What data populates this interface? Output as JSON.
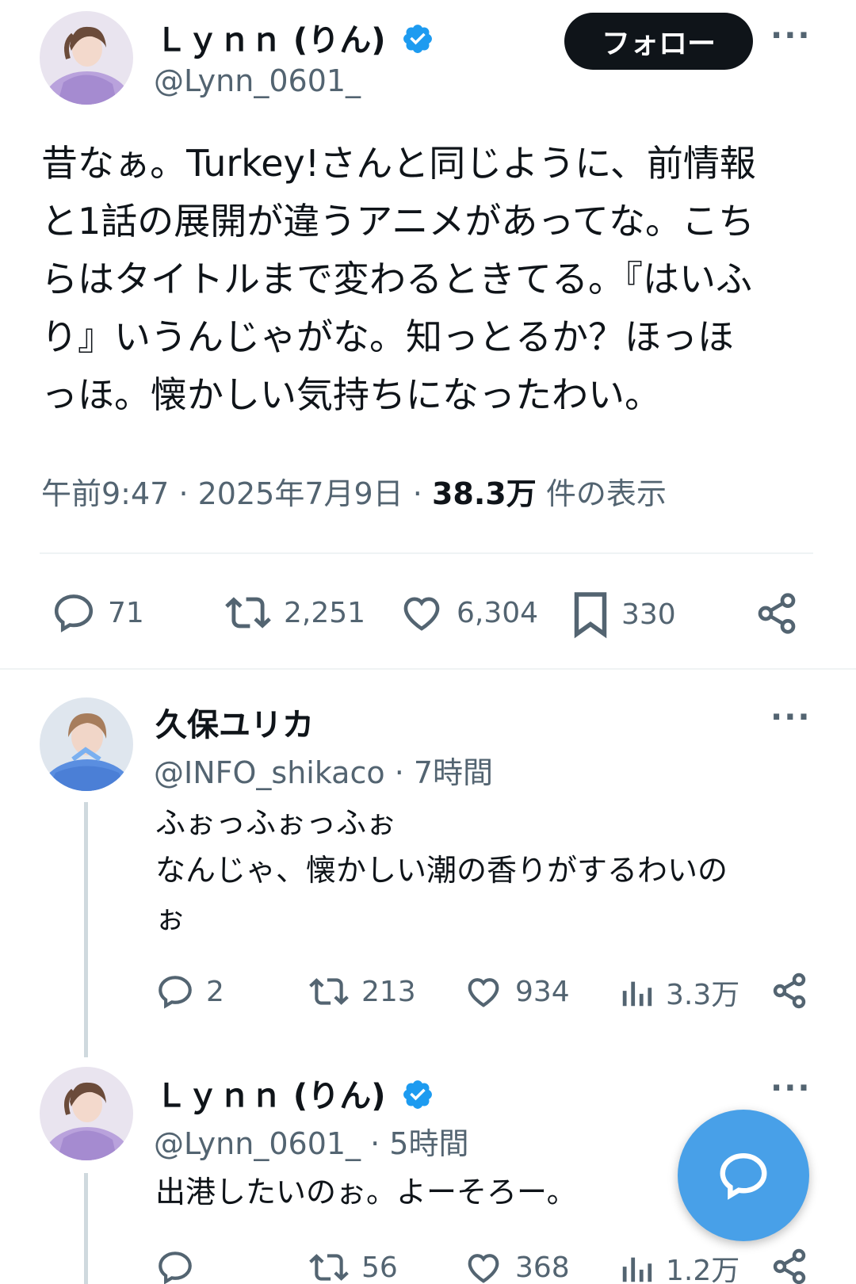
{
  "main_post": {
    "name": "Ｌｙｎｎ (りん)",
    "handle": "@Lynn_0601_",
    "follow_label": "フォロー",
    "more": "···",
    "lines": [
      "昔なぁ。Turkey!さんと同じように、前情報",
      "と1話の展開が違うアニメがあってな。こち",
      "らはタイトルまで変わるときてる。『はいふ",
      "り』いうんじゃがな。知っとるか？ほっほ",
      "っほ。懐かしい気持ちになったわい。"
    ],
    "time": "午前9:47",
    "date": "2025年7月9日",
    "sep": "·",
    "views_count": "38.3万",
    "views_label": "件の表示",
    "stats": {
      "replies": "71",
      "retweets": "2,251",
      "likes": "6,304",
      "bookmarks": "330"
    }
  },
  "replies": [
    {
      "name": "久保ユリカ",
      "handle": "@INFO_shikaco",
      "time": "· 7時間",
      "more": "···",
      "lines": [
        "ふぉっふぉっふぉ",
        "なんじゃ、懐かしい潮の香りがするわいの",
        "ぉ"
      ],
      "stats": {
        "replies": "2",
        "retweets": "213",
        "likes": "934",
        "views": "3.3万"
      }
    },
    {
      "name": "Ｌｙｎｎ (りん)",
      "handle": "@Lynn_0601_",
      "time": "· 5時間",
      "more": "···",
      "lines": [
        "出港したいのぉ。よーそろー。"
      ],
      "stats": {
        "replies": "",
        "retweets": "56",
        "likes": "368",
        "views": "1.2万"
      }
    }
  ],
  "colors": {
    "text": "#0f1419",
    "secondary": "#536471",
    "verified": "#1d9bf0",
    "fab": "#48a0e8",
    "divider": "#eff3f4",
    "thread_line": "#cfd9de"
  },
  "icons": {
    "reply": "speech-bubble-icon",
    "retweet": "retweet-icon",
    "like": "heart-icon",
    "bookmark": "bookmark-icon",
    "views": "bar-chart-icon",
    "share": "share-icon",
    "verified": "verified-badge-icon",
    "compose": "compose-reply-icon"
  }
}
